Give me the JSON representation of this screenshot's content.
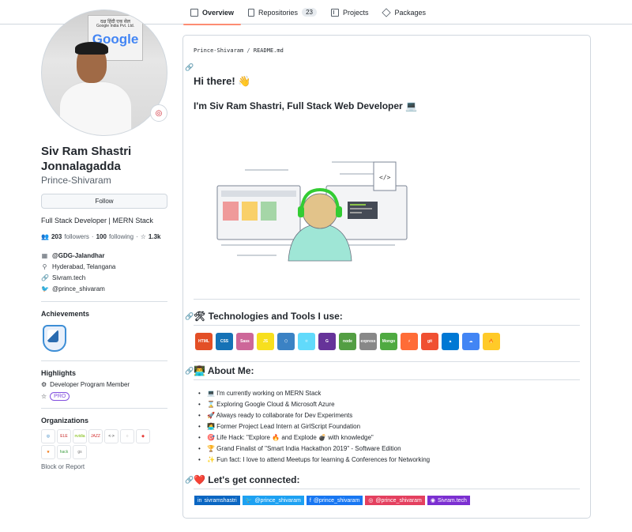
{
  "tabs": [
    {
      "label": "Overview",
      "icon": "book-icon",
      "active": true
    },
    {
      "label": "Repositories",
      "icon": "repo-icon",
      "count": "23"
    },
    {
      "label": "Projects",
      "icon": "project-icon"
    },
    {
      "label": "Packages",
      "icon": "package-icon"
    }
  ],
  "profile": {
    "avatar_sign_title": "दक्ष हिंदी एक सेल",
    "avatar_sign_sub": "Google India Pvt. Ltd.",
    "avatar_logo": "Google",
    "full_name": "Siv Ram Shastri Jonnalagadda",
    "username": "Prince-Shivaram",
    "follow_label": "Follow",
    "bio": "Full Stack Developer | MERN Stack",
    "followers_count": "203",
    "followers_label": "followers",
    "following_count": "100",
    "following_label": "following",
    "stars_count": "1.3k",
    "company": "@GDG-Jalandhar",
    "location": "Hyderabad, Telangana",
    "website": "Sivram.tech",
    "twitter": "@prince_shivaram"
  },
  "sidebar": {
    "achievements_title": "Achievements",
    "highlights_title": "Highlights",
    "highlight_dev": "Developer Program Member",
    "highlight_pro": "PRO",
    "organizations_title": "Organizations",
    "orgs": [
      {
        "label": "◎",
        "color": "#1b75bb"
      },
      {
        "label": "ELE",
        "color": "#c62828"
      },
      {
        "label": "nvidia",
        "color": "#76b900"
      },
      {
        "label": "JAZZ",
        "color": "#d32f2f"
      },
      {
        "label": "<·>",
        "color": "#333333"
      },
      {
        "label": "○",
        "color": "#9e9e9e"
      },
      {
        "label": "◆",
        "color": "#e53935"
      },
      {
        "label": "★",
        "color": "#ef6c00"
      },
      {
        "label": "hack",
        "color": "#43a047"
      },
      {
        "label": "gs",
        "color": "#757575"
      }
    ],
    "block_report": "Block or Report"
  },
  "readme": {
    "path_owner": "Prince-Shivaram",
    "path_sep": " / ",
    "path_file": "README.md",
    "greeting": "Hi there! 👋",
    "intro": "I'm Siv Ram Shastri, Full Stack Web Developer 💻",
    "tech_heading": "🛠 Technologies and Tools I use:",
    "tech": [
      {
        "label": "HTML",
        "color": "#e34f26"
      },
      {
        "label": "CSS",
        "color": "#1572b6"
      },
      {
        "label": "Sass",
        "color": "#cd6799"
      },
      {
        "label": "JS",
        "color": "#f7df1e"
      },
      {
        "label": "⬡",
        "color": "#3b82c4"
      },
      {
        "label": "⚛",
        "color": "#61dafb"
      },
      {
        "label": "G",
        "color": "#663399"
      },
      {
        "label": "node",
        "color": "#539e43"
      },
      {
        "label": "express",
        "color": "#888888"
      },
      {
        "label": "Mongo",
        "color": "#4faa41"
      },
      {
        "label": "⚡",
        "color": "#ff6c37"
      },
      {
        "label": "git",
        "color": "#f05032"
      },
      {
        "label": "▲",
        "color": "#0078d4"
      },
      {
        "label": "☁",
        "color": "#4285f4"
      },
      {
        "label": "🔥",
        "color": "#ffca28"
      }
    ],
    "about_heading": "👨‍💻 About Me:",
    "about": [
      "💻 I'm currently working on MERN Stack",
      "⌛ Exploring Google Cloud & Microsoft Azure",
      "🚀 Always ready to collaborate for Dev Experiments",
      "👩‍💻 Former Project Lead Intern at GirlScript Foundation",
      "🎯 Life Hack: \"Explore 🔥 and Explode 💣 with knowledge\"",
      "🏆 Grand Finalist of \"Smart India Hackathon 2019\" - Software Edition",
      "✨ Fun fact: I love to attend Meetups for learning & Conferences for Networking"
    ],
    "connect_heading": "❤️ Let's get connected:",
    "socials": [
      {
        "label": "sivramshastri",
        "icon": "linkedin-icon",
        "glyph": "in",
        "color": "#0a66c2"
      },
      {
        "label": "@prince_shivaram",
        "icon": "twitter-icon",
        "glyph": "🐦",
        "color": "#1da1f2"
      },
      {
        "label": "@prince_shivaram",
        "icon": "facebook-icon",
        "glyph": "f",
        "color": "#1877f2"
      },
      {
        "label": "@prince_shivaram",
        "icon": "instagram-icon",
        "glyph": "◎",
        "color": "#e4405f"
      },
      {
        "label": "Sivram.tech",
        "icon": "website-icon",
        "glyph": "◉",
        "color": "#7b2fd1"
      }
    ]
  }
}
